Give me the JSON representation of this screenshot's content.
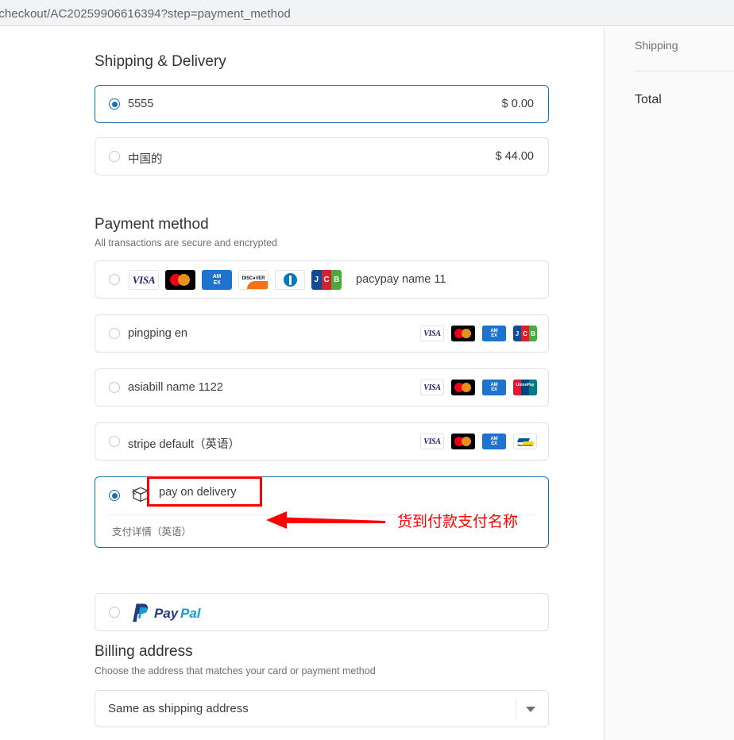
{
  "browser": {
    "url": "/checkout/AC20259906616394?step=payment_method"
  },
  "sidebar": {
    "shipping_label": "Shipping",
    "total_label": "Total"
  },
  "shipping_section": {
    "title": "Shipping & Delivery",
    "options": [
      {
        "label": "5555",
        "price": "$ 0.00",
        "selected": true
      },
      {
        "label": "中国的",
        "price": "$ 44.00",
        "selected": false
      }
    ]
  },
  "payment_section": {
    "title": "Payment method",
    "subtitle": "All transactions are secure and encrypted",
    "options": [
      {
        "label": "pacypay name 11",
        "selected": false,
        "icons_position": "left",
        "cards": [
          "visa",
          "mastercard",
          "amex",
          "discover",
          "diners",
          "jcb"
        ]
      },
      {
        "label": "pingping en",
        "selected": false,
        "icons_position": "right",
        "cards": [
          "visa",
          "mastercard",
          "amex",
          "jcb"
        ]
      },
      {
        "label": "asiabill name 1122",
        "selected": false,
        "icons_position": "right",
        "cards": [
          "visa",
          "mastercard",
          "amex",
          "unionpay"
        ]
      },
      {
        "label": "stripe default（英语）",
        "selected": false,
        "icons_position": "right",
        "cards": [
          "visa",
          "mastercard",
          "amex",
          "bancontact"
        ]
      }
    ],
    "pay_on_delivery": {
      "label": "pay on delivery",
      "sub_label": "支付详情（英语）",
      "selected": true,
      "icon": "box-icon"
    },
    "paypal": {
      "label": "PayPal",
      "selected": false
    }
  },
  "annotation": {
    "text": "货到付款支付名称",
    "color": "#ff0000"
  },
  "billing_section": {
    "title": "Billing address",
    "subtitle": "Choose the address that matches your card or payment method",
    "selected_value": "Same as shipping address"
  },
  "card_labels": {
    "visa": "VISA",
    "amex_line1": "AM",
    "amex_line2": "EX",
    "discover": "DISC●VER",
    "jcb_j": "J",
    "jcb_c": "C",
    "jcb_b": "B",
    "unionpay": "UnionPay",
    "bancontact": "Bancontact"
  },
  "colors": {
    "accent": "#1773b0",
    "annotation": "#ff0000",
    "visa": "#1a1f71",
    "amex": "#1f72cd",
    "discover_orange": "#f47216",
    "diners": "#0079be",
    "jcb_blue": "#0e4c96",
    "jcb_red": "#d6202e",
    "jcb_green": "#4aab3c",
    "paypal_dark": "#253b80",
    "paypal_light": "#179bd7"
  }
}
